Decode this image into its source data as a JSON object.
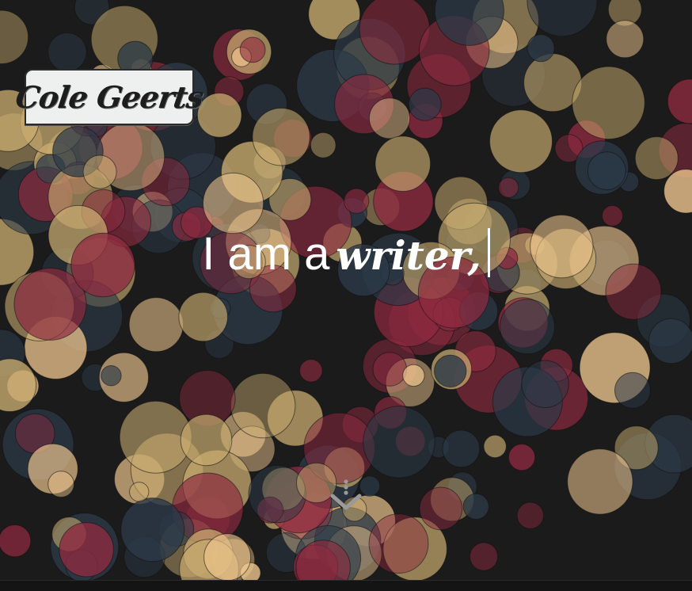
{
  "logo": {
    "text": "Cole Geerts"
  },
  "headline": {
    "lead": "I am a",
    "role": "writer,"
  },
  "scroll_button": {
    "icon": "chevron-down-dots-icon"
  },
  "colors": {
    "background": "#1b1b1b",
    "bokeh_gold": "#c9ac70",
    "bokeh_crimson": "#8e2a40",
    "bokeh_navy": "#2c3a48",
    "bokeh_peach": "#f1c890",
    "text": "#ffffff"
  }
}
